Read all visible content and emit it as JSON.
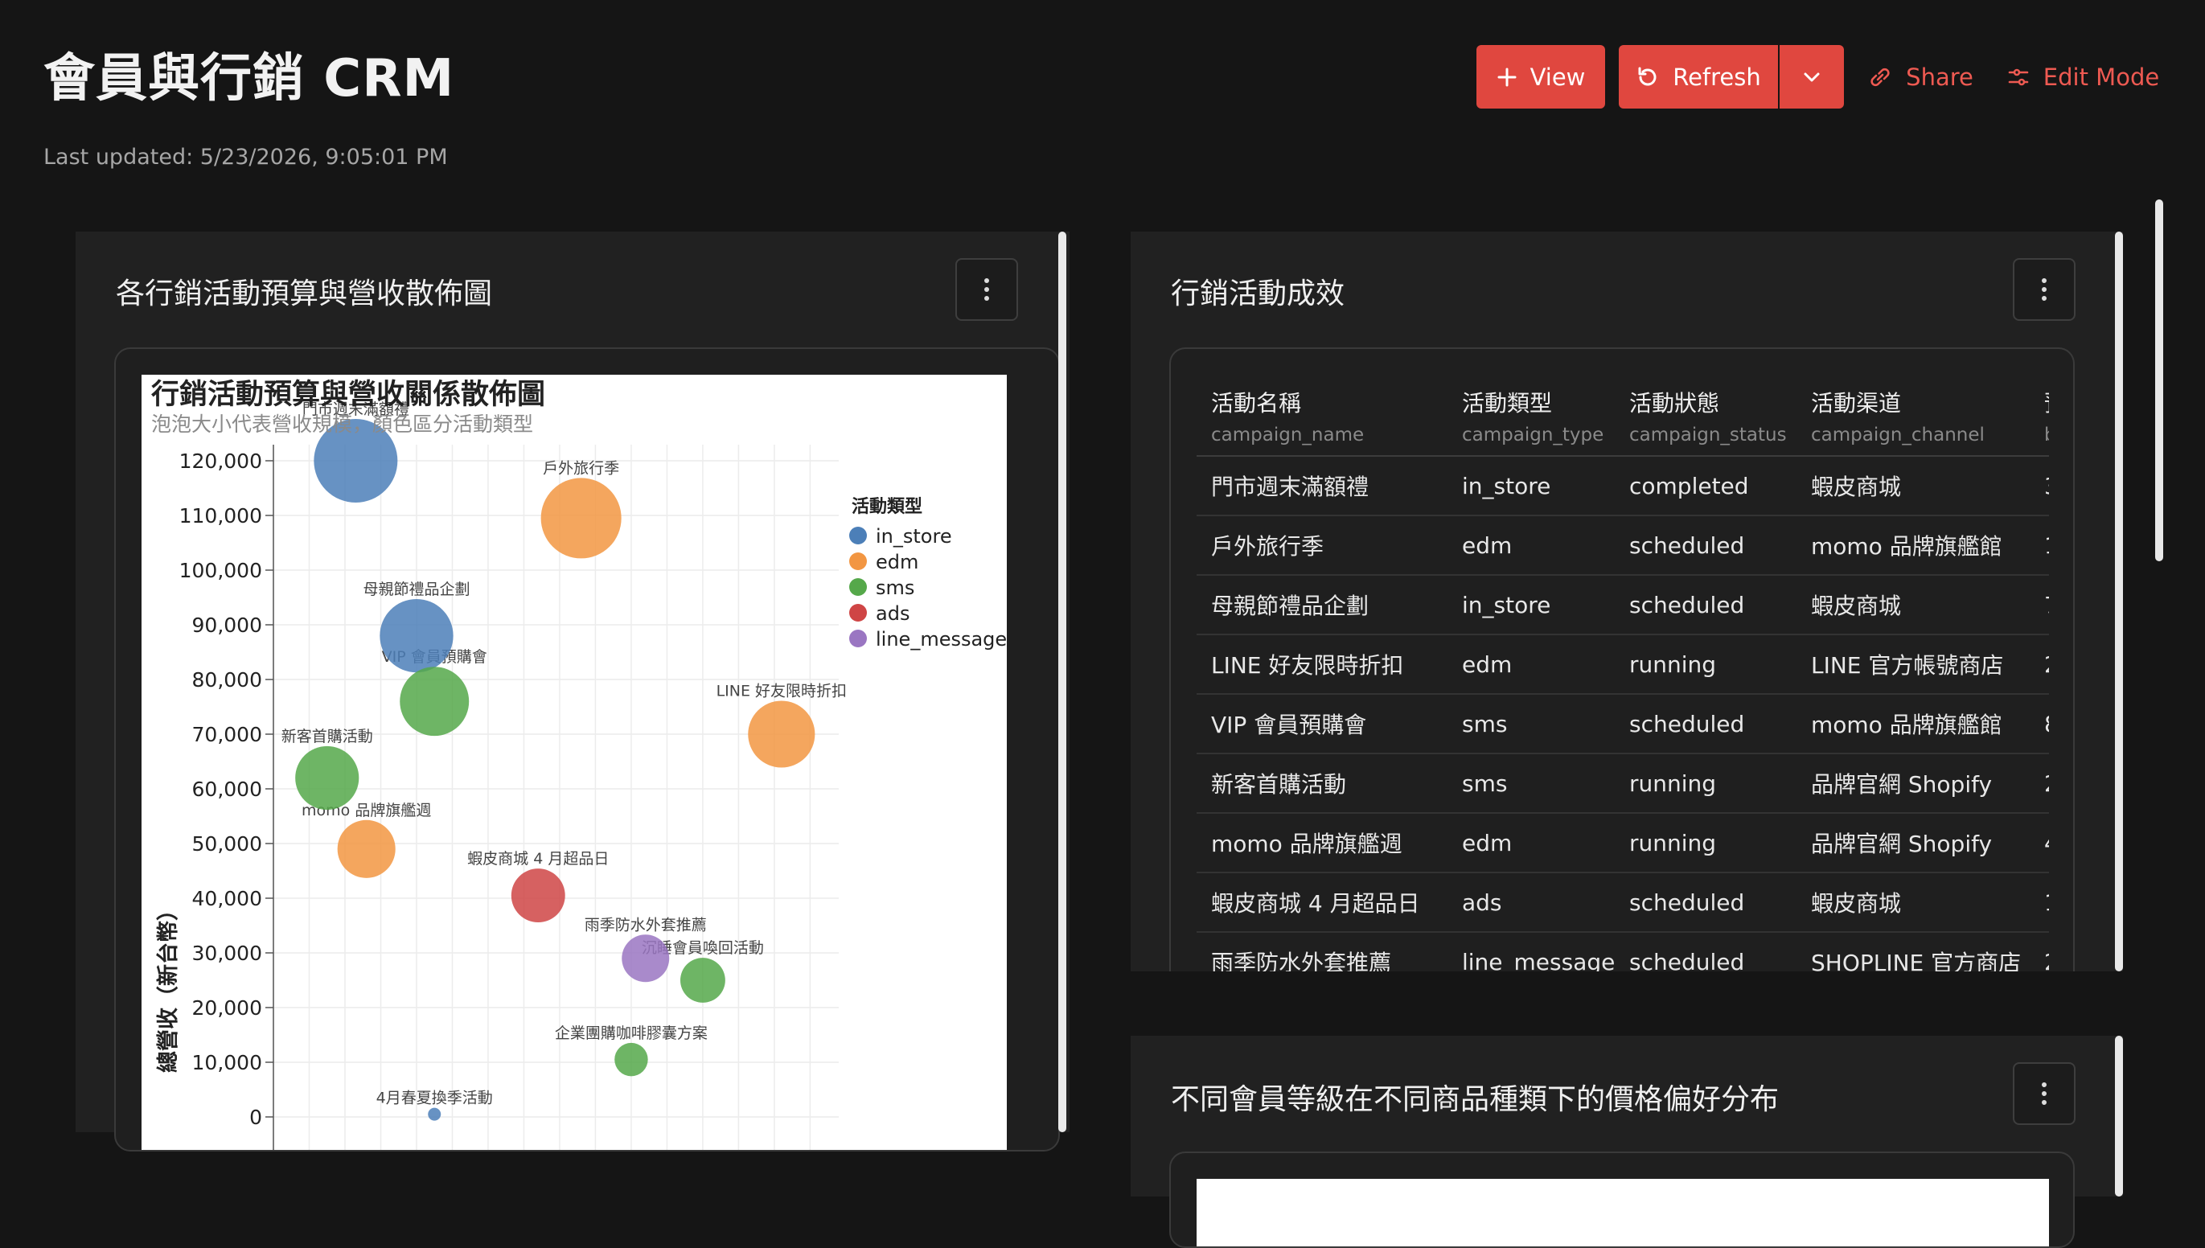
{
  "page": {
    "title": "會員與行銷 CRM",
    "last_updated": "Last updated: 5/23/2026, 9:05:01 PM"
  },
  "toolbar": {
    "view_label": "View",
    "refresh_label": "Refresh",
    "share_label": "Share",
    "edit_mode_label": "Edit Mode",
    "accent_color": "#e0473f"
  },
  "scatter_panel": {
    "title": "各行銷活動預算與營收散佈圖"
  },
  "campaign_panel": {
    "title": "行銷活動成效",
    "columns": [
      {
        "label": "活動名稱",
        "field": "campaign_name"
      },
      {
        "label": "活動類型",
        "field": "campaign_type"
      },
      {
        "label": "活動狀態",
        "field": "campaign_status"
      },
      {
        "label": "活動渠道",
        "field": "campaign_channel"
      },
      {
        "label": "預",
        "field": "b"
      }
    ],
    "rows": [
      {
        "name": "門市週末滿額禮",
        "type": "in_store",
        "status": "completed",
        "channel": "蝦皮商城",
        "extra": "3"
      },
      {
        "name": "戶外旅行季",
        "type": "edm",
        "status": "scheduled",
        "channel": "momo 品牌旗艦館",
        "extra": "1"
      },
      {
        "name": "母親節禮品企劃",
        "type": "in_store",
        "status": "scheduled",
        "channel": "蝦皮商城",
        "extra": "7"
      },
      {
        "name": "LINE 好友限時折扣",
        "type": "edm",
        "status": "running",
        "channel": "LINE 官方帳號商店",
        "extra": "2"
      },
      {
        "name": "VIP 會員預購會",
        "type": "sms",
        "status": "scheduled",
        "channel": "momo 品牌旗艦館",
        "extra": "8"
      },
      {
        "name": "新客首購活動",
        "type": "sms",
        "status": "running",
        "channel": "品牌官網 Shopify",
        "extra": "2"
      },
      {
        "name": "momo 品牌旗艦週",
        "type": "edm",
        "status": "running",
        "channel": "品牌官網 Shopify",
        "extra": "4"
      },
      {
        "name": "蝦皮商城 4 月超品日",
        "type": "ads",
        "status": "scheduled",
        "channel": "蝦皮商城",
        "extra": "1"
      },
      {
        "name": "雨季防水外套推薦",
        "type": "line_message",
        "status": "scheduled",
        "channel": "SHOPLINE 官方商店",
        "extra": "2"
      }
    ]
  },
  "member_panel": {
    "title": "不同會員等級在不同商品種類下的價格偏好分布"
  },
  "chart_data": {
    "type": "scatter",
    "title": "行銷活動預算與營收關係散佈圖",
    "subtitle": "泡泡大小代表營收規模，顏色區分活動類型",
    "xlabel": "",
    "ylabel": "總營收（新台幣）",
    "ylim": [
      0,
      120000
    ],
    "y_ticks": [
      "0",
      "10,000",
      "20,000",
      "30,000",
      "40,000",
      "50,000",
      "60,000",
      "70,000",
      "80,000",
      "90,000",
      "100,000",
      "110,000",
      "120,000"
    ],
    "x_grid_count": 15,
    "grid": true,
    "legend_position": "right",
    "legend_title": "活動類型",
    "series": [
      {
        "name": "in_store",
        "color": "#4c7fb8"
      },
      {
        "name": "edm",
        "color": "#f29642"
      },
      {
        "name": "sms",
        "color": "#55a84a"
      },
      {
        "name": "ads",
        "color": "#cf4545"
      },
      {
        "name": "line_message",
        "color": "#9a76c2"
      }
    ],
    "points": [
      {
        "label": "門市週末滿額禮",
        "type": "in_store",
        "x": 2.3,
        "y": 120000
      },
      {
        "label": "戶外旅行季",
        "type": "edm",
        "x": 8.6,
        "y": 109500
      },
      {
        "label": "母親節禮品企劃",
        "type": "in_store",
        "x": 4.0,
        "y": 88000
      },
      {
        "label": "VIP 會員預購會",
        "type": "sms",
        "x": 4.5,
        "y": 76000
      },
      {
        "label": "LINE 好友限時折扣",
        "type": "edm",
        "x": 14.2,
        "y": 70000
      },
      {
        "label": "新客首購活動",
        "type": "sms",
        "x": 1.5,
        "y": 62000
      },
      {
        "label": "momo 品牌旗艦週",
        "type": "edm",
        "x": 2.6,
        "y": 49000
      },
      {
        "label": "蝦皮商城 4 月超品日",
        "type": "ads",
        "x": 7.4,
        "y": 40500
      },
      {
        "label": "雨季防水外套推薦",
        "type": "line_message",
        "x": 10.4,
        "y": 29000
      },
      {
        "label": "沉睡會員喚回活動",
        "type": "sms",
        "x": 12.0,
        "y": 25000
      },
      {
        "label": "企業團購咖啡膠囊方案",
        "type": "sms",
        "x": 10.0,
        "y": 10500
      },
      {
        "label": "4月春夏換季活動",
        "type": "in_store",
        "x": 4.5,
        "y": 500
      }
    ]
  }
}
